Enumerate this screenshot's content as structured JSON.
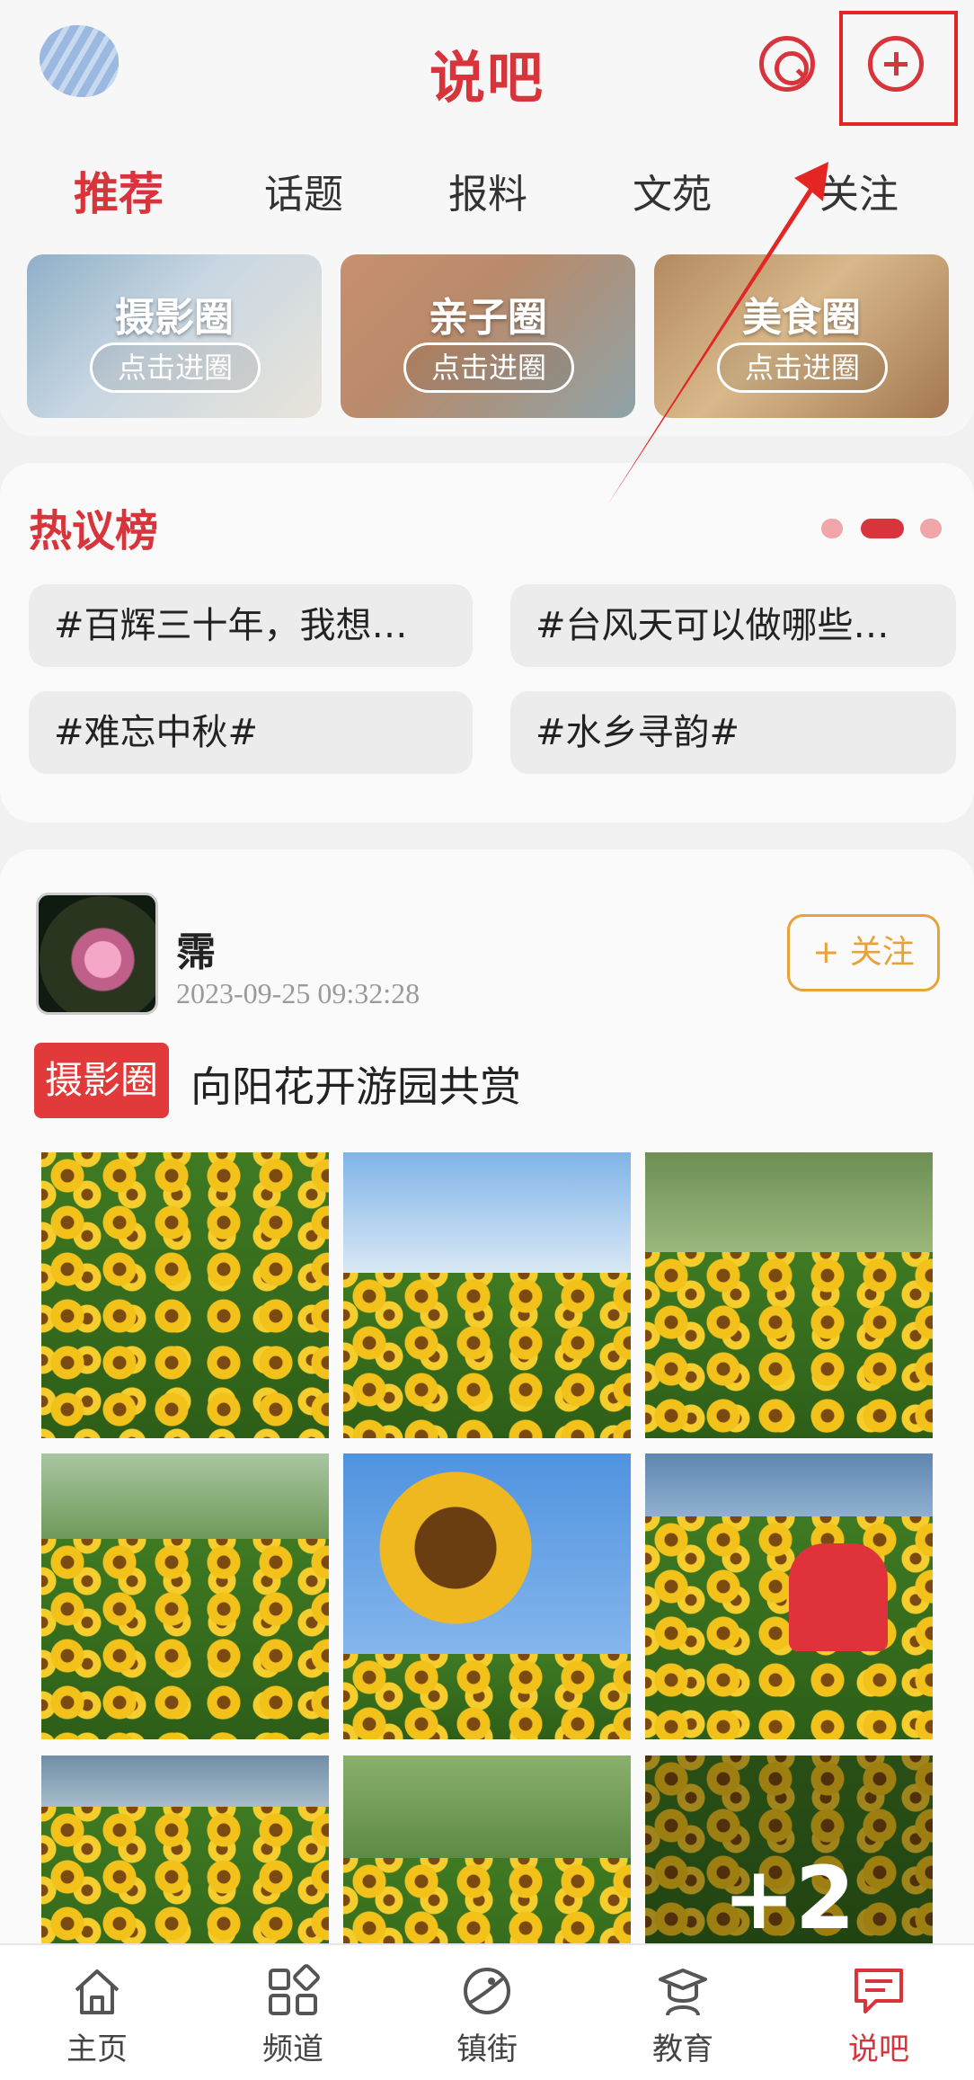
{
  "header": {
    "title": "说吧"
  },
  "tabs": [
    {
      "label": "推荐",
      "active": true
    },
    {
      "label": "话题"
    },
    {
      "label": "报料"
    },
    {
      "label": "文苑"
    },
    {
      "label": "关注"
    }
  ],
  "circles": [
    {
      "name": "摄影圈",
      "action": "点击进圈"
    },
    {
      "name": "亲子圈",
      "action": "点击进圈"
    },
    {
      "name": "美食圈",
      "action": "点击进圈"
    }
  ],
  "hot_board": {
    "title": "热议榜",
    "topics": [
      "#百辉三十年，我想…",
      "#台风天可以做哪些…",
      "#难忘中秋#",
      "#水乡寻韵#"
    ],
    "page_indicator": {
      "total": 3,
      "current": 2
    }
  },
  "post": {
    "user_name": "霈",
    "time": "2023-09-25 09:32:28",
    "follow_label": "+ 关注",
    "tag": "摄影圈",
    "text": "向阳花开游园共赏",
    "more_count": "+2"
  },
  "bottom_nav": [
    {
      "label": "主页",
      "icon": "home-icon"
    },
    {
      "label": "频道",
      "icon": "grid-icon"
    },
    {
      "label": "镇街",
      "icon": "planet-icon"
    },
    {
      "label": "教育",
      "icon": "graduation-icon"
    },
    {
      "label": "说吧",
      "icon": "chat-icon",
      "active": true
    }
  ],
  "colors": {
    "accent": "#d8343c",
    "follow": "#e8a23a",
    "annotation": "#e32524"
  }
}
